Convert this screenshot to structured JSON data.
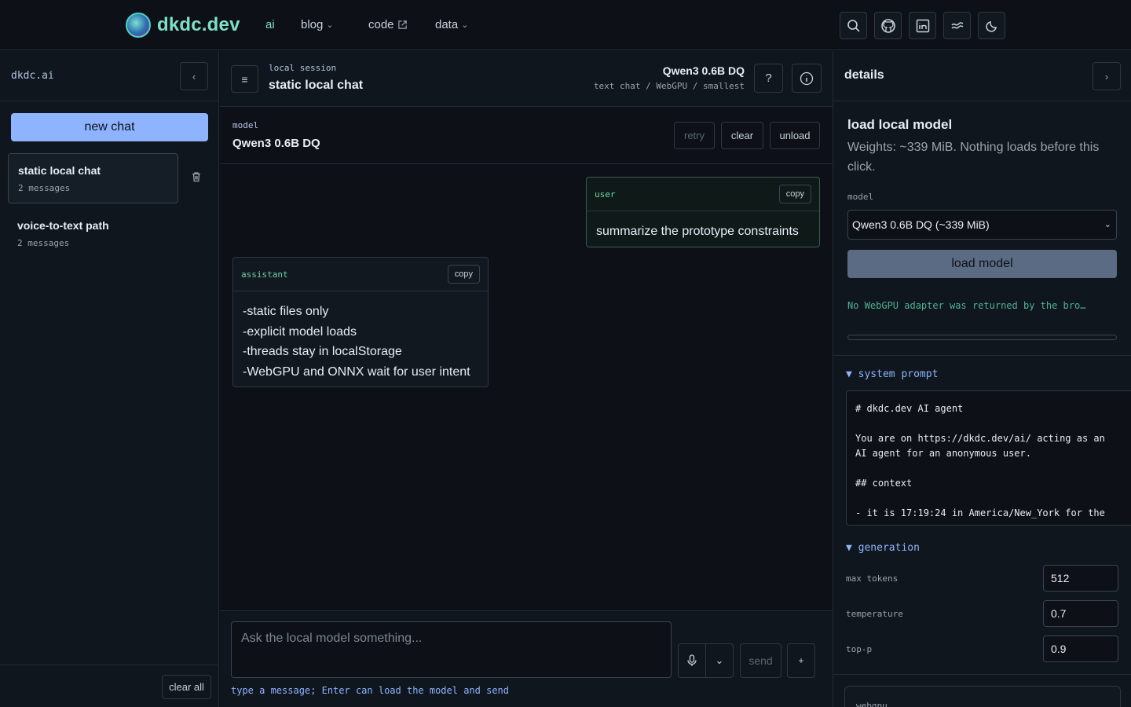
{
  "nav": {
    "logo_text": "dkdc.dev",
    "links": [
      "ai",
      "blog",
      "code",
      "data"
    ],
    "icons": [
      "search-icon",
      "github-icon",
      "linkedin-icon",
      "waves-icon",
      "moon-icon"
    ]
  },
  "left": {
    "title": "dkdc.ai",
    "collapse_glyph": "‹",
    "new_chat": "new chat",
    "threads": [
      {
        "title": "static local chat",
        "meta": "2 messages"
      },
      {
        "title": "voice-to-text path",
        "meta": "2 messages"
      }
    ],
    "clear_all": "clear all"
  },
  "center": {
    "session_label": "local session",
    "session_title": "static local chat",
    "model_name": "Qwen3 0.6B DQ",
    "model_sub": "text chat / WebGPU / smallest",
    "help_glyph": "?",
    "model_label": "model",
    "model_value": "Qwen3 0.6B DQ",
    "buttons": {
      "retry": "retry",
      "clear": "clear",
      "unload": "unload"
    },
    "messages": [
      {
        "role": "user",
        "copy": "copy",
        "text": "summarize the prototype constraints"
      },
      {
        "role": "assistant",
        "copy": "copy",
        "lines": [
          "-static files only",
          "-explicit model loads",
          "-threads stay in localStorage",
          "-WebGPU and ONNX wait for user intent"
        ]
      }
    ],
    "composer": {
      "placeholder": "Ask the local model something...",
      "send": "send",
      "plus": "+",
      "hint": "type a message; Enter can load the model and send"
    }
  },
  "right": {
    "title": "details",
    "expand_glyph": "›",
    "load_title": "load local model",
    "load_desc": "Weights: ~339 MiB. Nothing loads before this click.",
    "model_label": "model",
    "model_select": "Qwen3 0.6B DQ (~339 MiB)",
    "load_button": "load model",
    "status": "No WebGPU adapter was returned by the bro…",
    "system_prompt_label": "▼ system prompt",
    "system_prompt": "# dkdc.dev AI agent\n\nYou are on https://dkdc.dev/ai/ acting as an\nAI agent for an anonymous user.\n\n## context\n\n- it is 17:19:24 in America/New_York for the",
    "generation_label": "▼ generation",
    "generation": [
      {
        "label": "max tokens",
        "value": "512"
      },
      {
        "label": "temperature",
        "value": "0.7"
      },
      {
        "label": "top-p",
        "value": "0.9"
      }
    ],
    "webgpu_label": "webgpu"
  }
}
